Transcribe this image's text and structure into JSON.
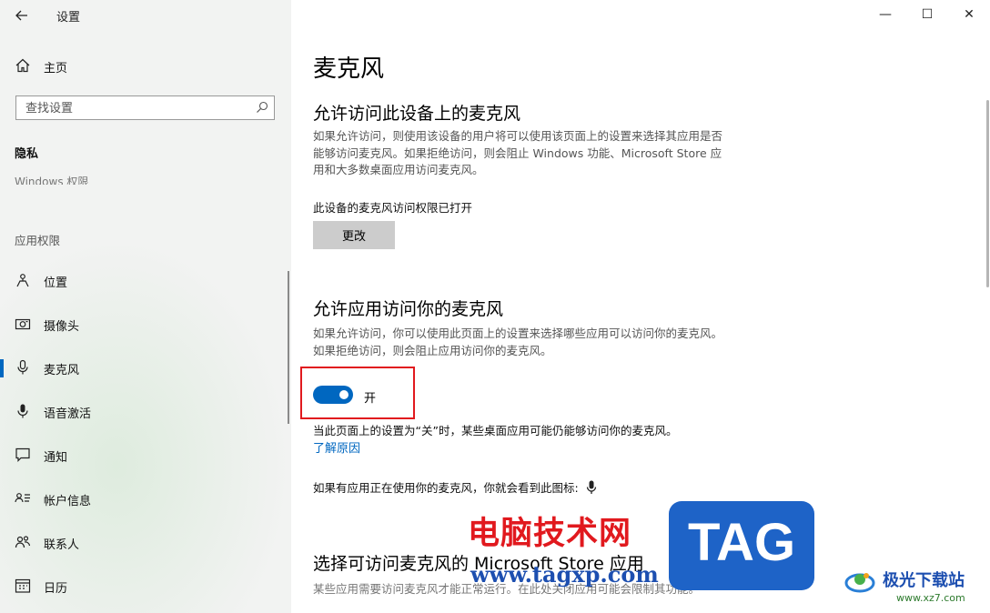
{
  "window": {
    "app_title": "设置",
    "back_icon": "back-arrow-icon",
    "controls": {
      "minimize": "—",
      "maximize": "☐",
      "close": "✕"
    }
  },
  "sidebar": {
    "home_label": "主页",
    "search_placeholder": "查找设置",
    "section_title": "隐私",
    "partial_item": "Windows 权限",
    "group_label": "应用权限",
    "items": [
      {
        "label": "位置",
        "icon": "location-icon"
      },
      {
        "label": "摄像头",
        "icon": "camera-icon"
      },
      {
        "label": "麦克风",
        "icon": "microphone-icon",
        "selected": true
      },
      {
        "label": "语音激活",
        "icon": "voice-activation-icon"
      },
      {
        "label": "通知",
        "icon": "notification-icon"
      },
      {
        "label": "帐户信息",
        "icon": "account-info-icon"
      },
      {
        "label": "联系人",
        "icon": "contacts-icon"
      },
      {
        "label": "日历",
        "icon": "calendar-icon"
      }
    ]
  },
  "main": {
    "page_title": "麦克风",
    "device_section": {
      "title": "允许访问此设备上的麦克风",
      "description": "如果允许访问，则使用该设备的用户将可以使用该页面上的设置来选择其应用是否能够访问麦克风。如果拒绝访问，则会阻止 Windows 功能、Microsoft Store 应用和大多数桌面应用访问麦克风。",
      "status": "此设备的麦克风访问权限已打开",
      "change_button": "更改"
    },
    "apps_section": {
      "title": "允许应用访问你的麦克风",
      "description": "如果允许访问，你可以使用此页面上的设置来选择哪些应用可以访问你的麦克风。如果拒绝访问，则会阻止应用访问你的麦克风。",
      "toggle_state": "开",
      "toggle_on": true,
      "note": "当此页面上的设置为“关”时，某些桌面应用可能仍能够访问你的麦克风。",
      "link": "了解原因",
      "icon_note": "如果有应用正在使用你的麦克风，你就会看到此图标:"
    },
    "store_section": {
      "title": "选择可访问麦克风的 Microsoft Store 应用",
      "description": "某些应用需要访问麦克风才能正常运行。在此处关闭应用可能会限制其功能。"
    }
  },
  "watermarks": {
    "site_name": "电脑技术网",
    "site_url": "www.tagxp.com",
    "tag": "TAG",
    "brand": "极光下载站",
    "brand_url": "www.xz7.com"
  },
  "colors": {
    "accent": "#0067c0",
    "highlight_frame": "#e1191e"
  }
}
